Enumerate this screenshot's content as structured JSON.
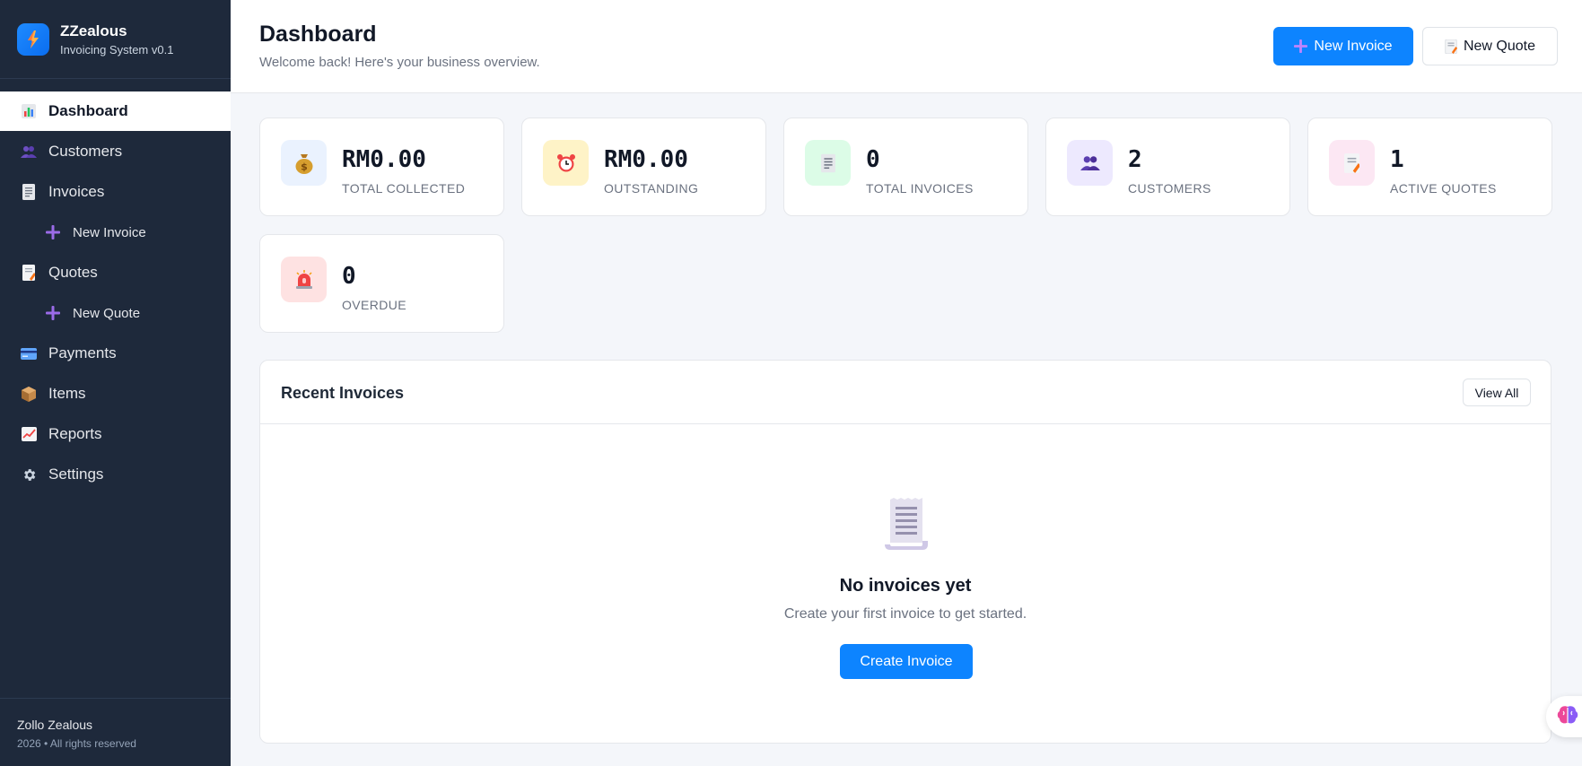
{
  "brand": {
    "name": "ZZealous",
    "subtitle": "Invoicing System v0.1",
    "logo_icon": "lightning-icon"
  },
  "sidebar": {
    "items": [
      {
        "label": "Dashboard",
        "icon": "bar-chart-icon",
        "active": true
      },
      {
        "label": "Customers",
        "icon": "users-icon"
      },
      {
        "label": "Invoices",
        "icon": "receipt-icon"
      },
      {
        "label": "New Invoice",
        "icon": "plus-icon",
        "sub": true
      },
      {
        "label": "Quotes",
        "icon": "document-icon"
      },
      {
        "label": "New Quote",
        "icon": "plus-icon",
        "sub": true
      },
      {
        "label": "Payments",
        "icon": "credit-card-icon"
      },
      {
        "label": "Items",
        "icon": "package-icon"
      },
      {
        "label": "Reports",
        "icon": "line-chart-icon"
      },
      {
        "label": "Settings",
        "icon": "gear-icon"
      }
    ],
    "footer": {
      "name": "Zollo Zealous",
      "copyright": "2026 • All rights reserved"
    }
  },
  "header": {
    "title": "Dashboard",
    "welcome": "Welcome back! Here's your business overview.",
    "new_invoice_label": "New Invoice",
    "new_quote_label": "New Quote"
  },
  "stats": [
    {
      "value": "RM0.00",
      "label": "TOTAL COLLECTED",
      "icon": "money-bag-icon",
      "bg": "#eaf2fe"
    },
    {
      "value": "RM0.00",
      "label": "OUTSTANDING",
      "icon": "alarm-clock-icon",
      "bg": "#fef3c7"
    },
    {
      "value": "0",
      "label": "TOTAL INVOICES",
      "icon": "receipt-icon",
      "bg": "#dcfce7"
    },
    {
      "value": "2",
      "label": "CUSTOMERS",
      "icon": "users-icon",
      "bg": "#ede9fe"
    },
    {
      "value": "1",
      "label": "ACTIVE QUOTES",
      "icon": "memo-icon",
      "bg": "#fce7f3"
    },
    {
      "value": "0",
      "label": "OVERDUE",
      "icon": "siren-icon",
      "bg": "#fee2e2"
    }
  ],
  "recent": {
    "title": "Recent Invoices",
    "view_all": "View All",
    "empty_title": "No invoices yet",
    "empty_subtitle": "Create your first invoice to get started.",
    "create_label": "Create Invoice"
  },
  "colors": {
    "sidebar_bg": "#1e293b",
    "accent": "#0d84ff"
  }
}
